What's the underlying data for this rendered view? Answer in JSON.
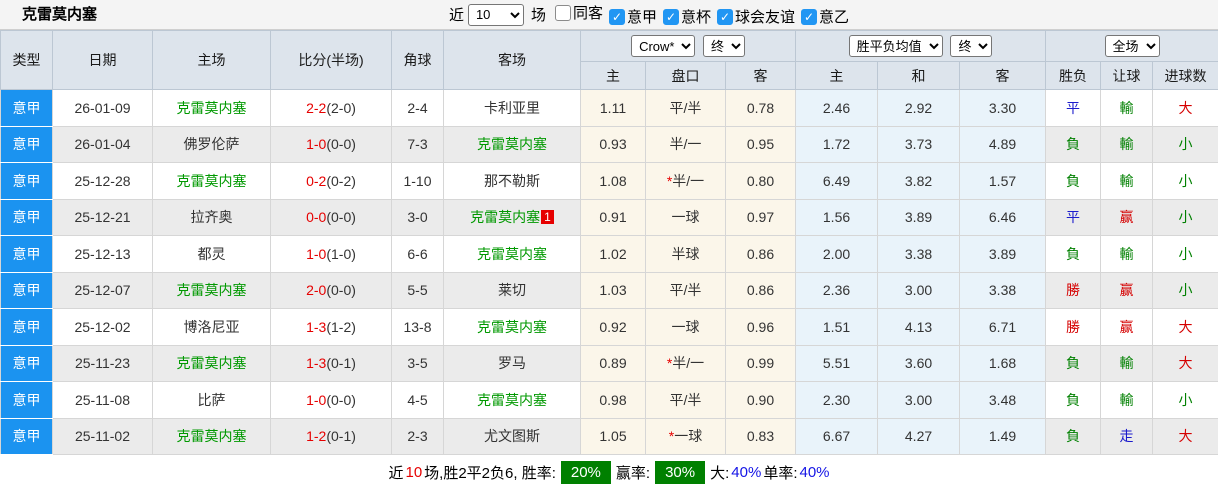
{
  "colors": {
    "league_bg": "#1b93f0",
    "team_green": "#009900",
    "score_red": "#e60000",
    "result_red": "#d50000",
    "result_green": "#008000",
    "result_blue": "#1b1bcc",
    "checkbox_blue": "#2196f3",
    "badge_green": "#008000",
    "pct_blue": "#1414e6"
  },
  "topbar": {
    "title": "克雷莫内塞",
    "near_label": "近",
    "match_count": "10",
    "matches_label": "场",
    "checkboxes": [
      {
        "label": "同客",
        "checked": false
      },
      {
        "label": "意甲",
        "checked": true
      },
      {
        "label": "意杯",
        "checked": true
      },
      {
        "label": "球会友谊",
        "checked": true
      },
      {
        "label": "意乙",
        "checked": true
      }
    ]
  },
  "table": {
    "left_headers": [
      "类型",
      "日期",
      "主场",
      "比分(半场)",
      "角球",
      "客场"
    ],
    "groups": [
      {
        "selects": [
          "Crow*",
          "终"
        ]
      },
      {
        "selects": [
          "胜平负均值",
          "终"
        ]
      },
      {
        "selects": [
          "全场"
        ]
      }
    ],
    "sub_headers": [
      "主",
      "盘口",
      "客",
      "主",
      "和",
      "客",
      "胜负",
      "让球",
      "进球数"
    ],
    "rows": [
      {
        "league": "意甲",
        "date": "26-01-09",
        "home": {
          "name": "克雷莫内塞",
          "green": true
        },
        "score": {
          "full": "2-2",
          "half": "(2-0)"
        },
        "corners": "2-4",
        "away": {
          "name": "卡利亚里",
          "green": false,
          "badge": ""
        },
        "crow": {
          "home": "1.11",
          "star": false,
          "handicap": "平/半",
          "away": "0.78"
        },
        "avg": [
          "2.46",
          "2.92",
          "3.30"
        ],
        "results": [
          {
            "t": "平",
            "c": "blue"
          },
          {
            "t": "輸",
            "c": "green"
          },
          {
            "t": "大",
            "c": "red"
          }
        ]
      },
      {
        "league": "意甲",
        "date": "26-01-04",
        "home": {
          "name": "佛罗伦萨",
          "green": false
        },
        "score": {
          "full": "1-0",
          "half": "(0-0)"
        },
        "corners": "7-3",
        "away": {
          "name": "克雷莫内塞",
          "green": true,
          "badge": ""
        },
        "crow": {
          "home": "0.93",
          "star": false,
          "handicap": "半/一",
          "away": "0.95"
        },
        "avg": [
          "1.72",
          "3.73",
          "4.89"
        ],
        "results": [
          {
            "t": "負",
            "c": "green"
          },
          {
            "t": "輸",
            "c": "green"
          },
          {
            "t": "小",
            "c": "green"
          }
        ]
      },
      {
        "league": "意甲",
        "date": "25-12-28",
        "home": {
          "name": "克雷莫内塞",
          "green": true
        },
        "score": {
          "full": "0-2",
          "half": "(0-2)"
        },
        "corners": "1-10",
        "away": {
          "name": "那不勒斯",
          "green": false,
          "badge": ""
        },
        "crow": {
          "home": "1.08",
          "star": true,
          "handicap": "半/一",
          "away": "0.80"
        },
        "avg": [
          "6.49",
          "3.82",
          "1.57"
        ],
        "results": [
          {
            "t": "負",
            "c": "green"
          },
          {
            "t": "輸",
            "c": "green"
          },
          {
            "t": "小",
            "c": "green"
          }
        ]
      },
      {
        "league": "意甲",
        "date": "25-12-21",
        "home": {
          "name": "拉齐奥",
          "green": false
        },
        "score": {
          "full": "0-0",
          "half": "(0-0)"
        },
        "corners": "3-0",
        "away": {
          "name": "克雷莫内塞",
          "green": true,
          "badge": "1"
        },
        "crow": {
          "home": "0.91",
          "star": false,
          "handicap": "一球",
          "away": "0.97"
        },
        "avg": [
          "1.56",
          "3.89",
          "6.46"
        ],
        "results": [
          {
            "t": "平",
            "c": "blue"
          },
          {
            "t": "赢",
            "c": "red"
          },
          {
            "t": "小",
            "c": "green"
          }
        ]
      },
      {
        "league": "意甲",
        "date": "25-12-13",
        "home": {
          "name": "都灵",
          "green": false
        },
        "score": {
          "full": "1-0",
          "half": "(1-0)"
        },
        "corners": "6-6",
        "away": {
          "name": "克雷莫内塞",
          "green": true,
          "badge": ""
        },
        "crow": {
          "home": "1.02",
          "star": false,
          "handicap": "半球",
          "away": "0.86"
        },
        "avg": [
          "2.00",
          "3.38",
          "3.89"
        ],
        "results": [
          {
            "t": "負",
            "c": "green"
          },
          {
            "t": "輸",
            "c": "green"
          },
          {
            "t": "小",
            "c": "green"
          }
        ]
      },
      {
        "league": "意甲",
        "date": "25-12-07",
        "home": {
          "name": "克雷莫内塞",
          "green": true
        },
        "score": {
          "full": "2-0",
          "half": "(0-0)"
        },
        "corners": "5-5",
        "away": {
          "name": "莱切",
          "green": false,
          "badge": ""
        },
        "crow": {
          "home": "1.03",
          "star": false,
          "handicap": "平/半",
          "away": "0.86"
        },
        "avg": [
          "2.36",
          "3.00",
          "3.38"
        ],
        "results": [
          {
            "t": "勝",
            "c": "red"
          },
          {
            "t": "赢",
            "c": "red"
          },
          {
            "t": "小",
            "c": "green"
          }
        ]
      },
      {
        "league": "意甲",
        "date": "25-12-02",
        "home": {
          "name": "博洛尼亚",
          "green": false
        },
        "score": {
          "full": "1-3",
          "half": "(1-2)"
        },
        "corners": "13-8",
        "away": {
          "name": "克雷莫内塞",
          "green": true,
          "badge": ""
        },
        "crow": {
          "home": "0.92",
          "star": false,
          "handicap": "一球",
          "away": "0.96"
        },
        "avg": [
          "1.51",
          "4.13",
          "6.71"
        ],
        "results": [
          {
            "t": "勝",
            "c": "red"
          },
          {
            "t": "赢",
            "c": "red"
          },
          {
            "t": "大",
            "c": "red"
          }
        ]
      },
      {
        "league": "意甲",
        "date": "25-11-23",
        "home": {
          "name": "克雷莫内塞",
          "green": true
        },
        "score": {
          "full": "1-3",
          "half": "(0-1)"
        },
        "corners": "3-5",
        "away": {
          "name": "罗马",
          "green": false,
          "badge": ""
        },
        "crow": {
          "home": "0.89",
          "star": true,
          "handicap": "半/一",
          "away": "0.99"
        },
        "avg": [
          "5.51",
          "3.60",
          "1.68"
        ],
        "results": [
          {
            "t": "負",
            "c": "green"
          },
          {
            "t": "輸",
            "c": "green"
          },
          {
            "t": "大",
            "c": "red"
          }
        ]
      },
      {
        "league": "意甲",
        "date": "25-11-08",
        "home": {
          "name": "比萨",
          "green": false
        },
        "score": {
          "full": "1-0",
          "half": "(0-0)"
        },
        "corners": "4-5",
        "away": {
          "name": "克雷莫内塞",
          "green": true,
          "badge": ""
        },
        "crow": {
          "home": "0.98",
          "star": false,
          "handicap": "平/半",
          "away": "0.90"
        },
        "avg": [
          "2.30",
          "3.00",
          "3.48"
        ],
        "results": [
          {
            "t": "負",
            "c": "green"
          },
          {
            "t": "輸",
            "c": "green"
          },
          {
            "t": "小",
            "c": "green"
          }
        ]
      },
      {
        "league": "意甲",
        "date": "25-11-02",
        "home": {
          "name": "克雷莫内塞",
          "green": true
        },
        "score": {
          "full": "1-2",
          "half": "(0-1)"
        },
        "corners": "2-3",
        "away": {
          "name": "尤文图斯",
          "green": false,
          "badge": ""
        },
        "crow": {
          "home": "1.05",
          "star": true,
          "handicap": "一球",
          "away": "0.83"
        },
        "avg": [
          "6.67",
          "4.27",
          "1.49"
        ],
        "results": [
          {
            "t": "負",
            "c": "green"
          },
          {
            "t": "走",
            "c": "blue"
          },
          {
            "t": "大",
            "c": "red"
          }
        ]
      }
    ]
  },
  "footer": {
    "parts": [
      {
        "t": "近",
        "c": "black"
      },
      {
        "t": "10",
        "c": "red"
      },
      {
        "t": "场,胜2平2负6, 胜率:",
        "c": "black"
      },
      {
        "t": "20%",
        "c": "badge"
      },
      {
        "t": "赢率:",
        "c": "black"
      },
      {
        "t": "30%",
        "c": "badge"
      },
      {
        "t": "大:",
        "c": "black"
      },
      {
        "t": "40%",
        "c": "blue"
      },
      {
        "t": " 单率:",
        "c": "black"
      },
      {
        "t": "40%",
        "c": "blue"
      }
    ]
  }
}
